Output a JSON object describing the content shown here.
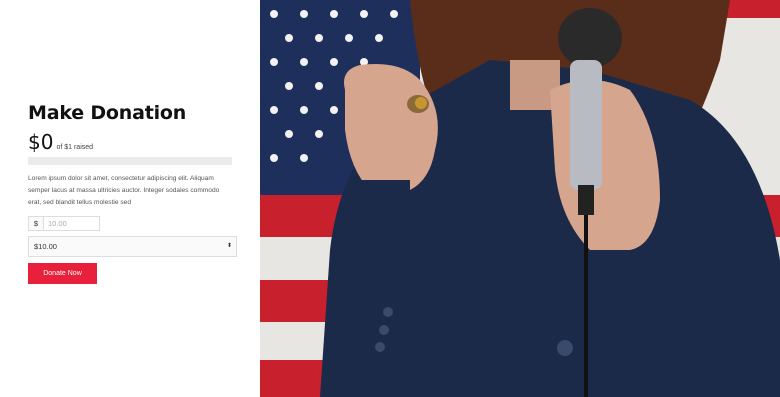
{
  "donation": {
    "title": "Make Donation",
    "amount_raised": "$0",
    "raised_of_text": "of $1 raised",
    "progress_fraction": 0,
    "description": "Lorem ipsum dolor sit amet, consectetur adipiscing elit. Aliquam semper lacus at massa ultricies auctor. Integer sodales commodo erat, sed blandit tellus molestie sed",
    "currency_symbol": "$",
    "amount_placeholder": "10.00",
    "selected_amount": "$10.00",
    "donate_button_label": "Donate Now"
  },
  "colors": {
    "accent": "#e8203c",
    "progress_track": "#ebebeb"
  },
  "hero_image": {
    "subject": "woman in navy blazer holding microphone in front of American flag"
  }
}
